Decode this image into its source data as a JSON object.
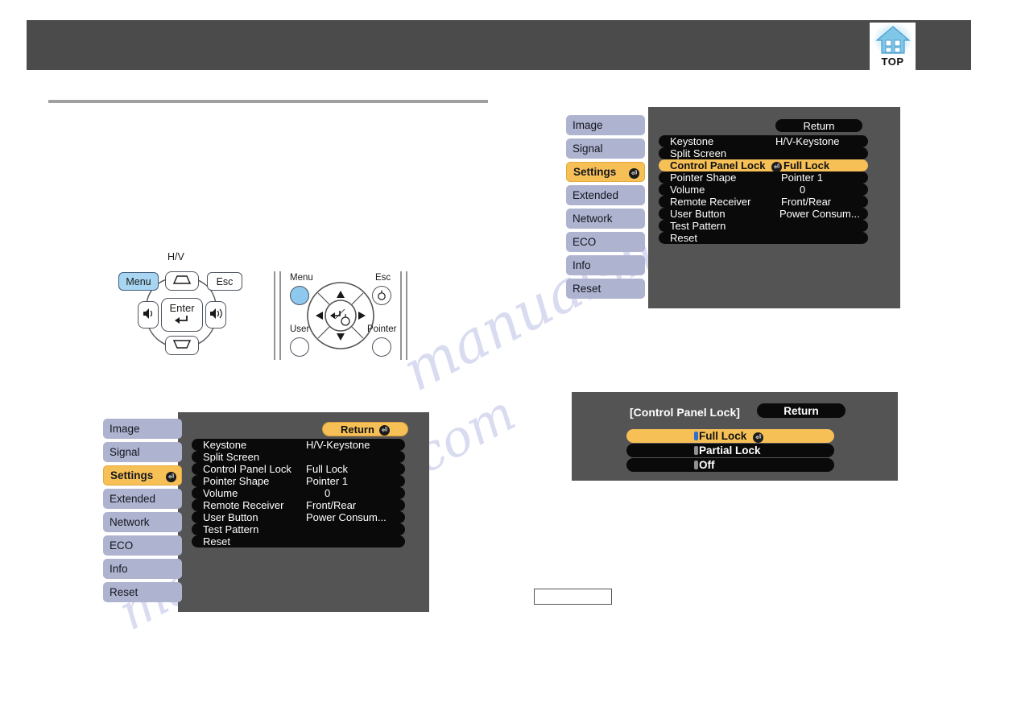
{
  "header": {
    "top_badge_label": "TOP",
    "badge_icon": "home-icon"
  },
  "control_panel_diagram": {
    "menu_label": "Menu",
    "esc_label": "Esc",
    "enter_label": "Enter",
    "keystone_label": "H/V",
    "icons": {
      "keystone_up": "keystone-up-icon",
      "keystone_down": "keystone-down-icon",
      "volume_down": "volume-down-icon",
      "volume_up": "volume-up-icon",
      "enter_arrow": "enter-arrow-icon"
    }
  },
  "remote_diagram": {
    "menu_label": "Menu",
    "esc_label": "Esc",
    "user_label": "User",
    "pointer_label": "Pointer",
    "icons": {
      "dpad_up": "arrow-up-icon",
      "dpad_down": "arrow-down-icon",
      "dpad_left": "arrow-left-icon",
      "dpad_right": "arrow-right-icon",
      "enter_center": "enter-icon",
      "esc_glyph": "pointer-hand-icon"
    }
  },
  "settings_menu": {
    "sidebar": [
      {
        "label": "Image",
        "selected": false
      },
      {
        "label": "Signal",
        "selected": false
      },
      {
        "label": "Settings",
        "selected": true
      },
      {
        "label": "Extended",
        "selected": false
      },
      {
        "label": "Network",
        "selected": false
      },
      {
        "label": "ECO",
        "selected": false
      },
      {
        "label": "Info",
        "selected": false
      },
      {
        "label": "Reset",
        "selected": false
      }
    ],
    "return_label": "Return",
    "rows": [
      {
        "label": "Keystone",
        "value": "H/V-Keystone",
        "highlighted": false
      },
      {
        "label": "Split Screen",
        "value": "",
        "highlighted": false
      },
      {
        "label": "Control Panel Lock",
        "value": "Full Lock",
        "highlighted": false
      },
      {
        "label": "Pointer Shape",
        "value": "Pointer 1",
        "highlighted": false
      },
      {
        "label": "Volume",
        "value": "0",
        "highlighted": false
      },
      {
        "label": "Remote Receiver",
        "value": "Front/Rear",
        "highlighted": false
      },
      {
        "label": "User Button",
        "value": "Power Consum...",
        "highlighted": false
      },
      {
        "label": "Test Pattern",
        "value": "",
        "highlighted": false
      },
      {
        "label": "Reset",
        "value": "",
        "highlighted": false
      }
    ]
  },
  "settings_menu_locked": {
    "sidebar": [
      {
        "label": "Image",
        "selected": false
      },
      {
        "label": "Signal",
        "selected": false
      },
      {
        "label": "Settings",
        "selected": true
      },
      {
        "label": "Extended",
        "selected": false
      },
      {
        "label": "Network",
        "selected": false
      },
      {
        "label": "ECO",
        "selected": false
      },
      {
        "label": "Info",
        "selected": false
      },
      {
        "label": "Reset",
        "selected": false
      }
    ],
    "return_label": "Return",
    "rows": [
      {
        "label": "Keystone",
        "value": "H/V-Keystone",
        "highlighted": false
      },
      {
        "label": "Split Screen",
        "value": "",
        "highlighted": false
      },
      {
        "label": "Control Panel Lock",
        "value": "Full Lock",
        "highlighted": true
      },
      {
        "label": "Pointer Shape",
        "value": "Pointer 1",
        "highlighted": false
      },
      {
        "label": "Volume",
        "value": "0",
        "highlighted": false
      },
      {
        "label": "Remote Receiver",
        "value": "Front/Rear",
        "highlighted": false
      },
      {
        "label": "User Button",
        "value": "Power Consum...",
        "highlighted": false
      },
      {
        "label": "Test Pattern",
        "value": "",
        "highlighted": false
      },
      {
        "label": "Reset",
        "value": "",
        "highlighted": false
      }
    ]
  },
  "control_panel_lock_dialog": {
    "title": "[Control Panel Lock]",
    "return_label": "Return",
    "options": [
      {
        "label": "Full Lock",
        "selected": true
      },
      {
        "label": "Partial Lock",
        "selected": false
      },
      {
        "label": "Off",
        "selected": false
      }
    ]
  },
  "colors": {
    "header_bar": "#4b4b4b",
    "osd_panel": "#545454",
    "osd_row": "#0a0a0a",
    "highlight": "#f6c057",
    "sidebar_item": "#aeb3d0",
    "radio_on": "#2f6fd0",
    "menu_button_highlight": "#a8d6f2"
  },
  "watermark": {
    "text_left": "manualshive.com",
    "text_right": "manualshive.com"
  }
}
